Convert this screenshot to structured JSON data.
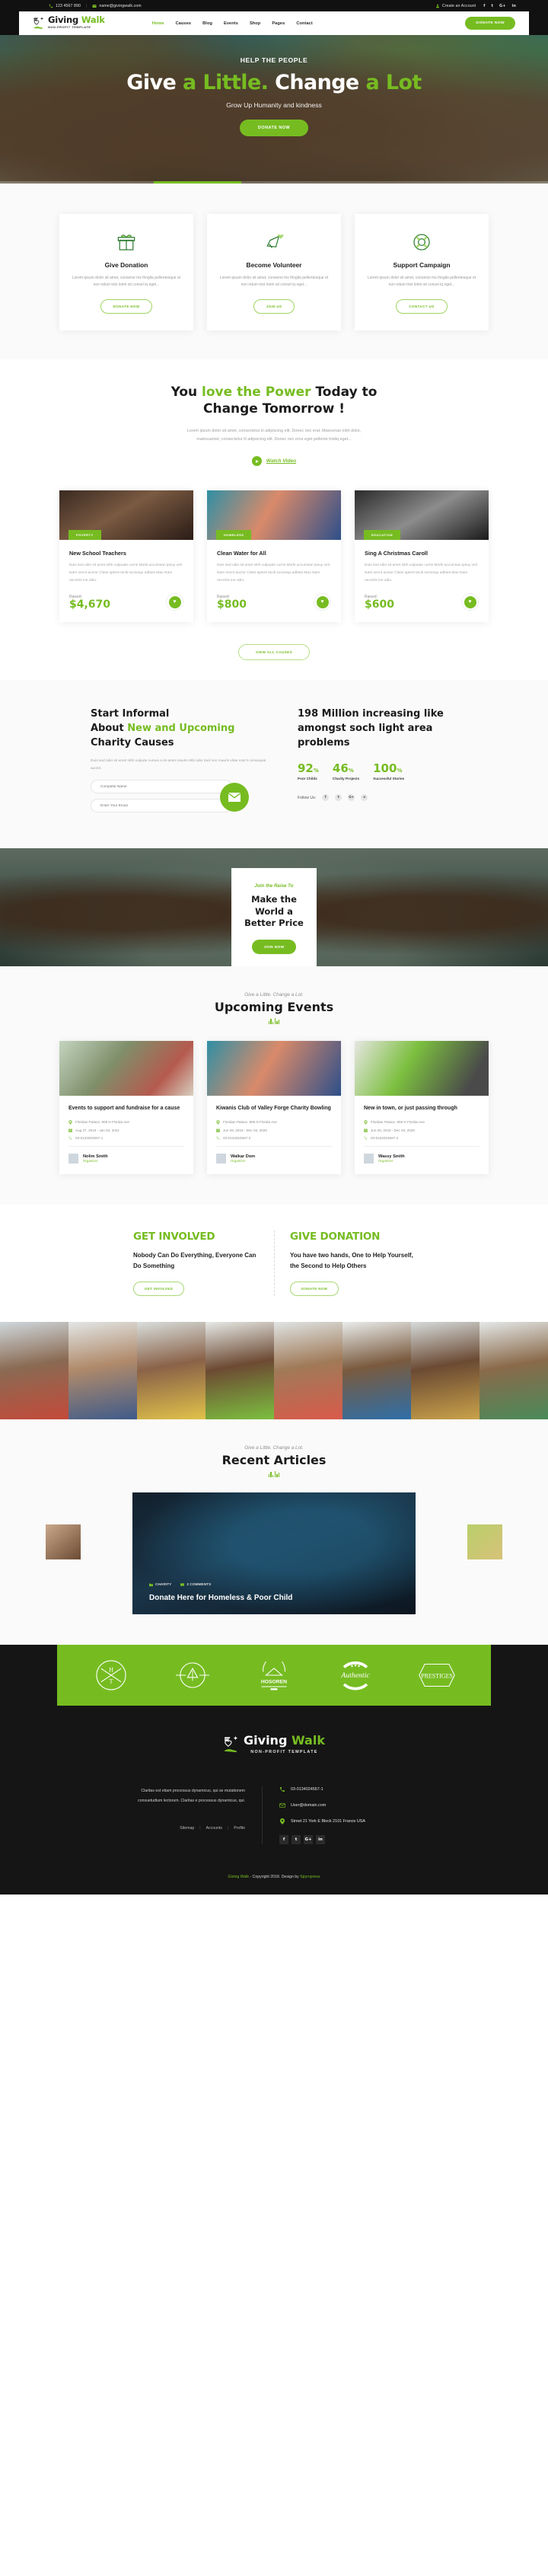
{
  "topbar": {
    "phone": "123 4567 890",
    "email": "name@givingwalk.com",
    "account": "Create an Account",
    "socials": [
      "f",
      "t",
      "G+",
      "in"
    ]
  },
  "header": {
    "logo_title_1": "Giving",
    "logo_title_2": "Walk",
    "logo_sub": "NON-PROFIT TEMPLATE",
    "nav": [
      "Home",
      "Causes",
      "Blog",
      "Events",
      "Shop",
      "Pages",
      "Contact"
    ],
    "donate_label": "DONATE NOW"
  },
  "hero": {
    "kicker": "HELP THE PEOPLE",
    "title_1": "Give ",
    "title_2": "a Little.",
    "title_3": " Change ",
    "title_4": "a Lot",
    "subtitle": "Grow Up Humanity and kindness",
    "button": "DONATE NOW"
  },
  "services": [
    {
      "icon": "gift-icon",
      "title": "Give Donation",
      "text": "Lorem ipsum dolor sit amet, consensi ms fringila pellentesque et non ndum trist lorim sit consel iq eget...",
      "button": "DONATE NOW"
    },
    {
      "icon": "megaphone-heart-icon",
      "title": "Become Volunteer",
      "text": "Lorem ipsum dolor sit amet, consensi ms fringila pellentesque et non ndum trist lorim sit consel iq eget...",
      "button": "JOIN US"
    },
    {
      "icon": "lifebuoy-icon",
      "title": "Support Campaign",
      "text": "Lorem ipsum dolor sit amet, consensi ms fringila pellentesque et non ndum trist lorim sit consel iq eget...",
      "button": "CONTACT US"
    }
  ],
  "power": {
    "title_1": "You ",
    "title_2": "love the Power",
    "title_3": " Today to",
    "title_4": "Change Tomorrow !",
    "text": "Lorem ipsum dolor sit amet, consectetur ili adipiscing elit. Donec nec erat. Maecenas nibh dolor, malesuamet, consectetur ili adipiscing elit. Donec nec eros eget pellente tristiq eget...",
    "watch": "Watch Video"
  },
  "causes": [
    {
      "tag": "POVERTY",
      "title": "New School Teachers",
      "text": "Duis sed odio sit amet nibh vulpuate curris Morbi accumsan ipsuy veli. Nam necnt auctor Class aptent taciti sociosqu adbiea Mau Nam necntris ine odio.",
      "raised_label": "Raised:",
      "amount": "$4,670"
    },
    {
      "tag": "HOMELESS",
      "title": "Clean Water for All",
      "text": "Duis sed odio sit amet nibh vulpuate curris Morbi accumsan ipsuy veli. Nam necnt auctor Class aptent taciti sociosqu adbiea Mau Nam necntris ine odio.",
      "raised_label": "Raised:",
      "amount": "$800"
    },
    {
      "tag": "EDUCATION",
      "title": "Sing A Christmas Caroll",
      "text": "Duis sed odio sit amet nibh vulpuate curris Morbi accumsan ipsuy veli. Nam necnt auctor Class aptent taciti sociosqu adbiea Mau Nam necntris ine odio.",
      "raised_label": "Raised:",
      "amount": "$600"
    }
  ],
  "view_all_causes": "VIEW ALL CAUSES",
  "informal": {
    "title_1": "Start Informal",
    "title_2": "About ",
    "title_3": "New and Upcoming",
    "title_4": "Charity Causes",
    "text": "Duis sed odio sit amet nibh vulpute cursus a sit amet mauris Mbi odio Sed non mauris vitae erat it consequat auctor.",
    "input_name_placeholder": "Complete Name",
    "input_email_placeholder": "Enter Your Email",
    "stats_title": "198 Million increasing like amongst soch light area problems",
    "stats": [
      {
        "value": "92",
        "unit": "%",
        "label": "Poor Childs"
      },
      {
        "value": "46",
        "unit": "%",
        "label": "Charity Projects"
      },
      {
        "value": "100",
        "unit": "%",
        "label": "Successful Stories"
      }
    ],
    "follow_label": "Follow Us:",
    "follow_socials": [
      "f",
      "t",
      "G+",
      "v"
    ]
  },
  "raise": {
    "kicker": "Join the Raise To",
    "title": "Make the World a Better Price",
    "button": "JOIN NOW"
  },
  "events_section": {
    "kicker": "Give a Little. Change a Lot.",
    "title": "Upcoming Events"
  },
  "events": [
    {
      "title": "Events to support and fundraise for a cause",
      "place": "Floridan Palace, 905 N Florida Ave",
      "date": "Aug 27, 2016 - Jan 04, 2021",
      "phone": "03-0134024567-1",
      "organizer": "Nolim Smith",
      "organizer_role": "Organizer"
    },
    {
      "title": "Kiwanis Club of Valley Forge Charity Bowling",
      "place": "Floridan Palace, 905 N Florida Ave",
      "date": "Jun 28, 2018 - Dec 04, 2020",
      "phone": "03-0134024567-2",
      "organizer": "Walkar Dom",
      "organizer_role": "Organizer"
    },
    {
      "title": "New in town, or just passing through",
      "place": "Floridan Palace, 905 N Florida Ave",
      "date": "Jun 28, 2018 - Dec 04, 2020",
      "phone": "03-0134024567-2",
      "organizer": "Wassy Smith",
      "organizer_role": "Organizer"
    }
  ],
  "involved": [
    {
      "heading": "GET INVOLVED",
      "text": "Nobody Can Do Everything, Everyone Can Do Something",
      "button": "GET INVOLVED"
    },
    {
      "heading": "GIVE DONATION",
      "text": "You have two hands, One to Help Yourself, the Second to Help Others",
      "button": "DONATE NOW"
    }
  ],
  "articles_section": {
    "kicker": "Give a Little. Change a Lot.",
    "title": "Recent Articles",
    "featured": {
      "category": "CHARITY",
      "comments": "2 COMMENTS",
      "title": "Donate Here for Homeless & Poor Child"
    }
  },
  "brands": [
    "HT",
    "ORIGINAL DESIGN",
    "HOSOREN",
    "Authentic",
    "PRESTIGES"
  ],
  "footer": {
    "logo_title_1": "Giving",
    "logo_title_2": "Walk",
    "logo_sub": "NON-PROFIT TEMPLATE",
    "about": "Claritas est etiam processus dynamicus, qui se mutationem consuetudium lectorum. Claritas e processus dynamicus, qui.",
    "links": [
      "Sitemap",
      "Accounts",
      "Profile"
    ],
    "phone": "03-0134024567-1",
    "email": "User@domain.com",
    "address": "Street 21 York E Block 2101 France USA",
    "socials": [
      "f",
      "t",
      "G+",
      "in"
    ],
    "copyright_brand": "Giving Walk",
    "copyright_text": " - Copyright 2018. Design by ",
    "copyright_author": "Spyropress"
  },
  "colors": {
    "accent": "#76bc21",
    "dark": "#151515",
    "light": "#fafafa"
  }
}
